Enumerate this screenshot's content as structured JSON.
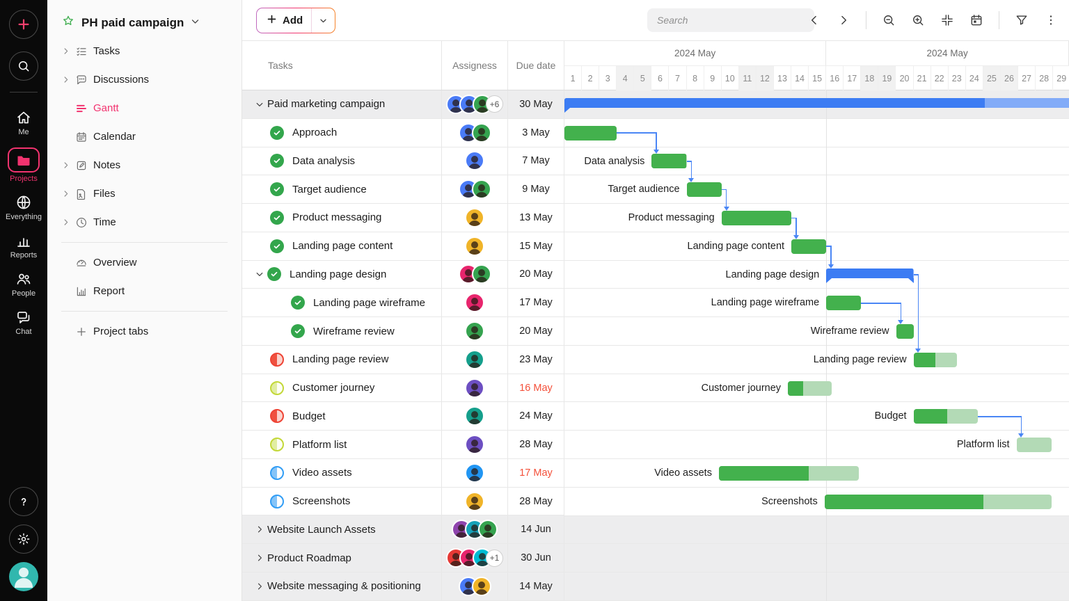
{
  "colors": {
    "brand_pink": "#f2336f",
    "bar_green": "#43b14d",
    "bar_green_light": "#b3dab6",
    "bar_blue": "#3c7cf3",
    "bar_blue_light": "#82abf8",
    "dependency_blue": "#4a86f5",
    "overdue_red": "#f4503a",
    "group_row_bg": "#ededee",
    "status_done_green": "#33a64c",
    "status_red": "#ee4334",
    "status_lime": "#c3d838",
    "status_blue": "#319df5"
  },
  "rail": {
    "top_buttons": [
      {
        "id": "create",
        "icon": "plus-icon"
      },
      {
        "id": "global-search",
        "icon": "search-icon"
      }
    ],
    "items": [
      {
        "id": "me",
        "label": "Me",
        "icon": "home-icon",
        "active": false
      },
      {
        "id": "projects",
        "label": "Projects",
        "icon": "folder-icon",
        "active": true
      },
      {
        "id": "everything",
        "label": "Everything",
        "icon": "globe-icon",
        "active": false
      },
      {
        "id": "reports",
        "label": "Reports",
        "icon": "bar-chart-icon",
        "active": false
      },
      {
        "id": "people",
        "label": "People",
        "icon": "people-icon",
        "active": false
      },
      {
        "id": "chat",
        "label": "Chat",
        "icon": "chat-icon",
        "active": false
      }
    ],
    "bottom_buttons": [
      {
        "id": "help",
        "icon": "help-icon"
      },
      {
        "id": "settings",
        "icon": "gear-icon"
      },
      {
        "id": "profile",
        "icon": "avatar"
      }
    ]
  },
  "sidebar": {
    "title": "PH paid campaign",
    "items": [
      {
        "id": "tasks",
        "label": "Tasks",
        "icon": "task-list-icon",
        "expandable": true,
        "active": false
      },
      {
        "id": "discussions",
        "label": "Discussions",
        "icon": "speech-bubble-icon",
        "expandable": true,
        "active": false
      },
      {
        "id": "gantt",
        "label": "Gantt",
        "icon": "gantt-bars-icon",
        "expandable": false,
        "active": true
      },
      {
        "id": "calendar",
        "label": "Calendar",
        "icon": "calendar-icon",
        "expandable": false,
        "active": false
      },
      {
        "id": "notes",
        "label": "Notes",
        "icon": "note-icon",
        "expandable": true,
        "active": false
      },
      {
        "id": "files",
        "label": "Files",
        "icon": "file-icon",
        "expandable": true,
        "active": false
      },
      {
        "id": "time",
        "label": "Time",
        "icon": "clock-icon",
        "expandable": true,
        "active": false
      }
    ],
    "secondary_items": [
      {
        "id": "overview",
        "label": "Overview",
        "icon": "gauge-icon"
      },
      {
        "id": "report",
        "label": "Report",
        "icon": "report-chart-icon"
      }
    ],
    "footer_item": {
      "id": "project-tabs",
      "label": "Project tabs",
      "icon": "plus-icon"
    }
  },
  "toolbar": {
    "add_label": "Add",
    "search_placeholder": "Search",
    "icons": [
      "chevron-left-icon",
      "chevron-right-icon",
      "separator",
      "zoom-out-icon",
      "zoom-in-icon",
      "collapse-icon",
      "calendar-today-icon",
      "separator",
      "filter-icon",
      "kebab-icon"
    ]
  },
  "table": {
    "columns": {
      "tasks": "Tasks",
      "assignees": "Assigness",
      "due": "Due date"
    }
  },
  "timeline": {
    "months": [
      {
        "label": "2024 May",
        "span_days": 15
      },
      {
        "label": "2024 May",
        "span_days": 14
      }
    ],
    "visible_days": [
      1,
      2,
      3,
      4,
      5,
      6,
      7,
      8,
      9,
      10,
      11,
      12,
      13,
      14,
      15,
      16,
      17,
      18,
      19,
      20,
      21,
      22,
      23,
      24,
      25,
      26,
      27,
      28,
      29
    ],
    "weekend_days": [
      4,
      5,
      11,
      12,
      18,
      19,
      25,
      26
    ]
  },
  "rows": [
    {
      "id": "campaign",
      "name": "Paid marketing campaign",
      "type": "group",
      "chevron": "down",
      "status": null,
      "avatars": [
        "#4a7bf7",
        "#4a7bf7",
        "#35a34f"
      ],
      "overflow": "+6",
      "due": "30 May",
      "due_red": false,
      "bar": {
        "kind": "summary",
        "start": 1,
        "end": 30.5,
        "progress": 0.817,
        "label_visible": false,
        "notch_right": false
      }
    },
    {
      "id": "approach",
      "name": "Approach",
      "type": "task",
      "chevron": null,
      "status": "done",
      "avatars": [
        "#4a7bf7",
        "#35a34f"
      ],
      "overflow": null,
      "due": "3 May",
      "due_red": false,
      "bar": {
        "kind": "task",
        "start": 1,
        "end": 4,
        "progress": 1,
        "label_visible": false
      }
    },
    {
      "id": "data-analysis",
      "name": "Data analysis",
      "type": "task",
      "chevron": null,
      "status": "done",
      "avatars": [
        "#4a7bf7"
      ],
      "overflow": null,
      "due": "7 May",
      "due_red": false,
      "bar": {
        "kind": "task",
        "start": 6,
        "end": 8,
        "progress": 1,
        "label_visible": true
      }
    },
    {
      "id": "target-audience",
      "name": "Target audience",
      "type": "task",
      "chevron": null,
      "status": "done",
      "avatars": [
        "#4a7bf7",
        "#35a34f"
      ],
      "overflow": null,
      "due": "9 May",
      "due_red": false,
      "bar": {
        "kind": "task",
        "start": 8,
        "end": 10,
        "progress": 1,
        "label_visible": true
      }
    },
    {
      "id": "product-messaging",
      "name": "Product messaging",
      "type": "task",
      "chevron": null,
      "status": "done",
      "avatars": [
        "#f0b429"
      ],
      "overflow": null,
      "due": "13 May",
      "due_red": false,
      "bar": {
        "kind": "task",
        "start": 10,
        "end": 14,
        "progress": 1,
        "label_visible": true
      }
    },
    {
      "id": "landing-page-content",
      "name": "Landing page content",
      "type": "task",
      "chevron": null,
      "status": "done",
      "avatars": [
        "#f0b429"
      ],
      "overflow": null,
      "due": "15 May",
      "due_red": false,
      "bar": {
        "kind": "task",
        "start": 14,
        "end": 16,
        "progress": 1,
        "label_visible": true
      }
    },
    {
      "id": "landing-page-design",
      "name": "Landing page design",
      "type": "task-expanded",
      "chevron": "down",
      "status": "done",
      "avatars": [
        "#e8256d",
        "#35a34f"
      ],
      "overflow": null,
      "due": "20 May",
      "due_red": false,
      "bar": {
        "kind": "summary",
        "start": 16,
        "end": 21,
        "progress": 1,
        "label_visible": true,
        "notch_right": true
      }
    },
    {
      "id": "landing-page-wireframe",
      "name": "Landing page wireframe",
      "type": "subtask",
      "chevron": null,
      "status": "done",
      "avatars": [
        "#e8256d"
      ],
      "overflow": null,
      "due": "17 May",
      "due_red": false,
      "bar": {
        "kind": "task",
        "start": 16,
        "end": 18,
        "progress": 1,
        "label_visible": true
      }
    },
    {
      "id": "wireframe-review",
      "name": "Wireframe review",
      "type": "subtask",
      "chevron": null,
      "status": "done",
      "avatars": [
        "#35a34f"
      ],
      "overflow": null,
      "due": "20 May",
      "due_red": false,
      "bar": {
        "kind": "task",
        "start": 20,
        "end": 21,
        "progress": 1,
        "label_visible": true
      }
    },
    {
      "id": "landing-page-review",
      "name": "Landing page review",
      "type": "task",
      "chevron": null,
      "status": "half-red",
      "avatars": [
        "#159f8c"
      ],
      "overflow": null,
      "due": "23 May",
      "due_red": false,
      "bar": {
        "kind": "task",
        "start": 21,
        "end": 23.5,
        "progress": 0.5,
        "label_visible": true
      }
    },
    {
      "id": "customer-journey",
      "name": "Customer journey",
      "type": "task",
      "chevron": null,
      "status": "half-lime",
      "avatars": [
        "#6d4fc2"
      ],
      "overflow": null,
      "due": "16 May",
      "due_red": true,
      "bar": {
        "kind": "task",
        "start": 13.8,
        "end": 16.3,
        "progress": 0.35,
        "label_visible": true
      }
    },
    {
      "id": "budget",
      "name": "Budget",
      "type": "task",
      "chevron": null,
      "status": "half-red",
      "avatars": [
        "#159f8c"
      ],
      "overflow": null,
      "due": "24 May",
      "due_red": false,
      "bar": {
        "kind": "task",
        "start": 21,
        "end": 24.7,
        "progress": 0.52,
        "label_visible": true
      }
    },
    {
      "id": "platform-list",
      "name": "Platform list",
      "type": "task",
      "chevron": null,
      "status": "half-lime",
      "avatars": [
        "#6d4fc2"
      ],
      "overflow": null,
      "due": "28 May",
      "due_red": false,
      "bar": {
        "kind": "task",
        "start": 26.9,
        "end": 28.9,
        "progress": 0,
        "label_visible": true
      }
    },
    {
      "id": "video-assets",
      "name": "Video assets",
      "type": "task",
      "chevron": null,
      "status": "half-blue",
      "avatars": [
        "#2196f3"
      ],
      "overflow": null,
      "due": "17 May",
      "due_red": true,
      "bar": {
        "kind": "task",
        "start": 9.85,
        "end": 17.85,
        "progress": 0.645,
        "label_visible": true
      }
    },
    {
      "id": "screenshots",
      "name": "Screenshots",
      "type": "task",
      "chevron": null,
      "status": "half-blue",
      "avatars": [
        "#f0b429"
      ],
      "overflow": null,
      "due": "28 May",
      "due_red": false,
      "bar": {
        "kind": "task",
        "start": 15.9,
        "end": 28.9,
        "progress": 0.7,
        "label_visible": true
      }
    },
    {
      "id": "website-launch-assets",
      "name": "Website Launch Assets",
      "type": "group",
      "chevron": "right",
      "status": null,
      "avatars": [
        "#8e44ad",
        "#16a2b8",
        "#35a34f"
      ],
      "overflow": null,
      "due": "14 Jun",
      "due_red": false,
      "bar": null
    },
    {
      "id": "product-roadmap",
      "name": "Product Roadmap",
      "type": "group",
      "chevron": "right",
      "status": null,
      "avatars": [
        "#e53935",
        "#e8256d",
        "#00bcd4"
      ],
      "overflow": "+1",
      "due": "30 Jun",
      "due_red": false,
      "bar": null
    },
    {
      "id": "website-messaging",
      "name": "Website messaging & positioning",
      "type": "group",
      "chevron": "right",
      "status": null,
      "avatars": [
        "#4a7bf7",
        "#f0b429"
      ],
      "overflow": null,
      "due": "14 May",
      "due_red": false,
      "bar": null
    }
  ],
  "dependencies": [
    {
      "from": "approach",
      "to": "data-analysis"
    },
    {
      "from": "data-analysis",
      "to": "target-audience"
    },
    {
      "from": "target-audience",
      "to": "product-messaging"
    },
    {
      "from": "product-messaging",
      "to": "landing-page-content"
    },
    {
      "from": "landing-page-content",
      "to": "landing-page-design"
    },
    {
      "from": "landing-page-design",
      "to": "landing-page-review"
    },
    {
      "from": "landing-page-wireframe",
      "to": "wireframe-review"
    },
    {
      "from": "budget",
      "to": "platform-list"
    }
  ]
}
